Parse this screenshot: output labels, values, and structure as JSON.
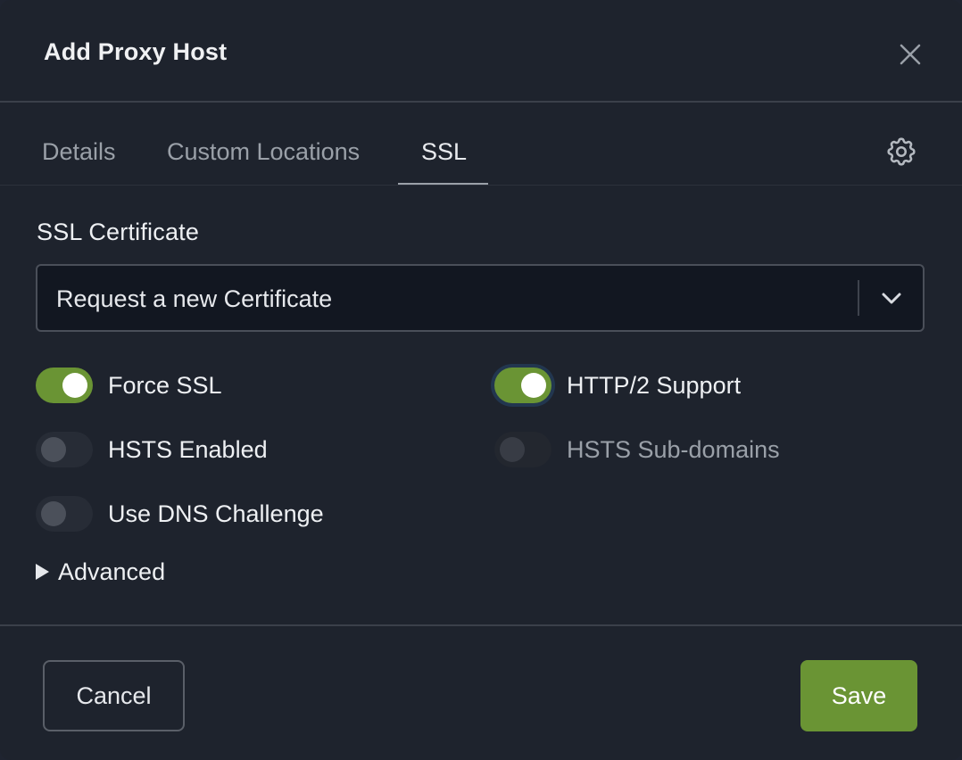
{
  "modal": {
    "title": "Add Proxy Host",
    "close_icon": "close-icon"
  },
  "tabs": [
    {
      "label": "Details",
      "active": false
    },
    {
      "label": "Custom Locations",
      "active": false
    },
    {
      "label": "SSL",
      "active": true
    }
  ],
  "settings_icon": "gear-icon",
  "ssl": {
    "certificate_label": "SSL Certificate",
    "certificate_value": "Request a new Certificate",
    "toggles": {
      "force_ssl": {
        "label": "Force SSL",
        "on": true
      },
      "http2": {
        "label": "HTTP/2 Support",
        "on": true
      },
      "hsts": {
        "label": "HSTS Enabled",
        "on": false
      },
      "hsts_subdomains": {
        "label": "HSTS Sub-domains",
        "on": false,
        "disabled": true
      },
      "dns_challenge": {
        "label": "Use DNS Challenge",
        "on": false
      }
    },
    "advanced_label": "Advanced"
  },
  "footer": {
    "cancel_label": "Cancel",
    "save_label": "Save"
  },
  "colors": {
    "accent": "#6a9434",
    "background": "#1e232d"
  }
}
